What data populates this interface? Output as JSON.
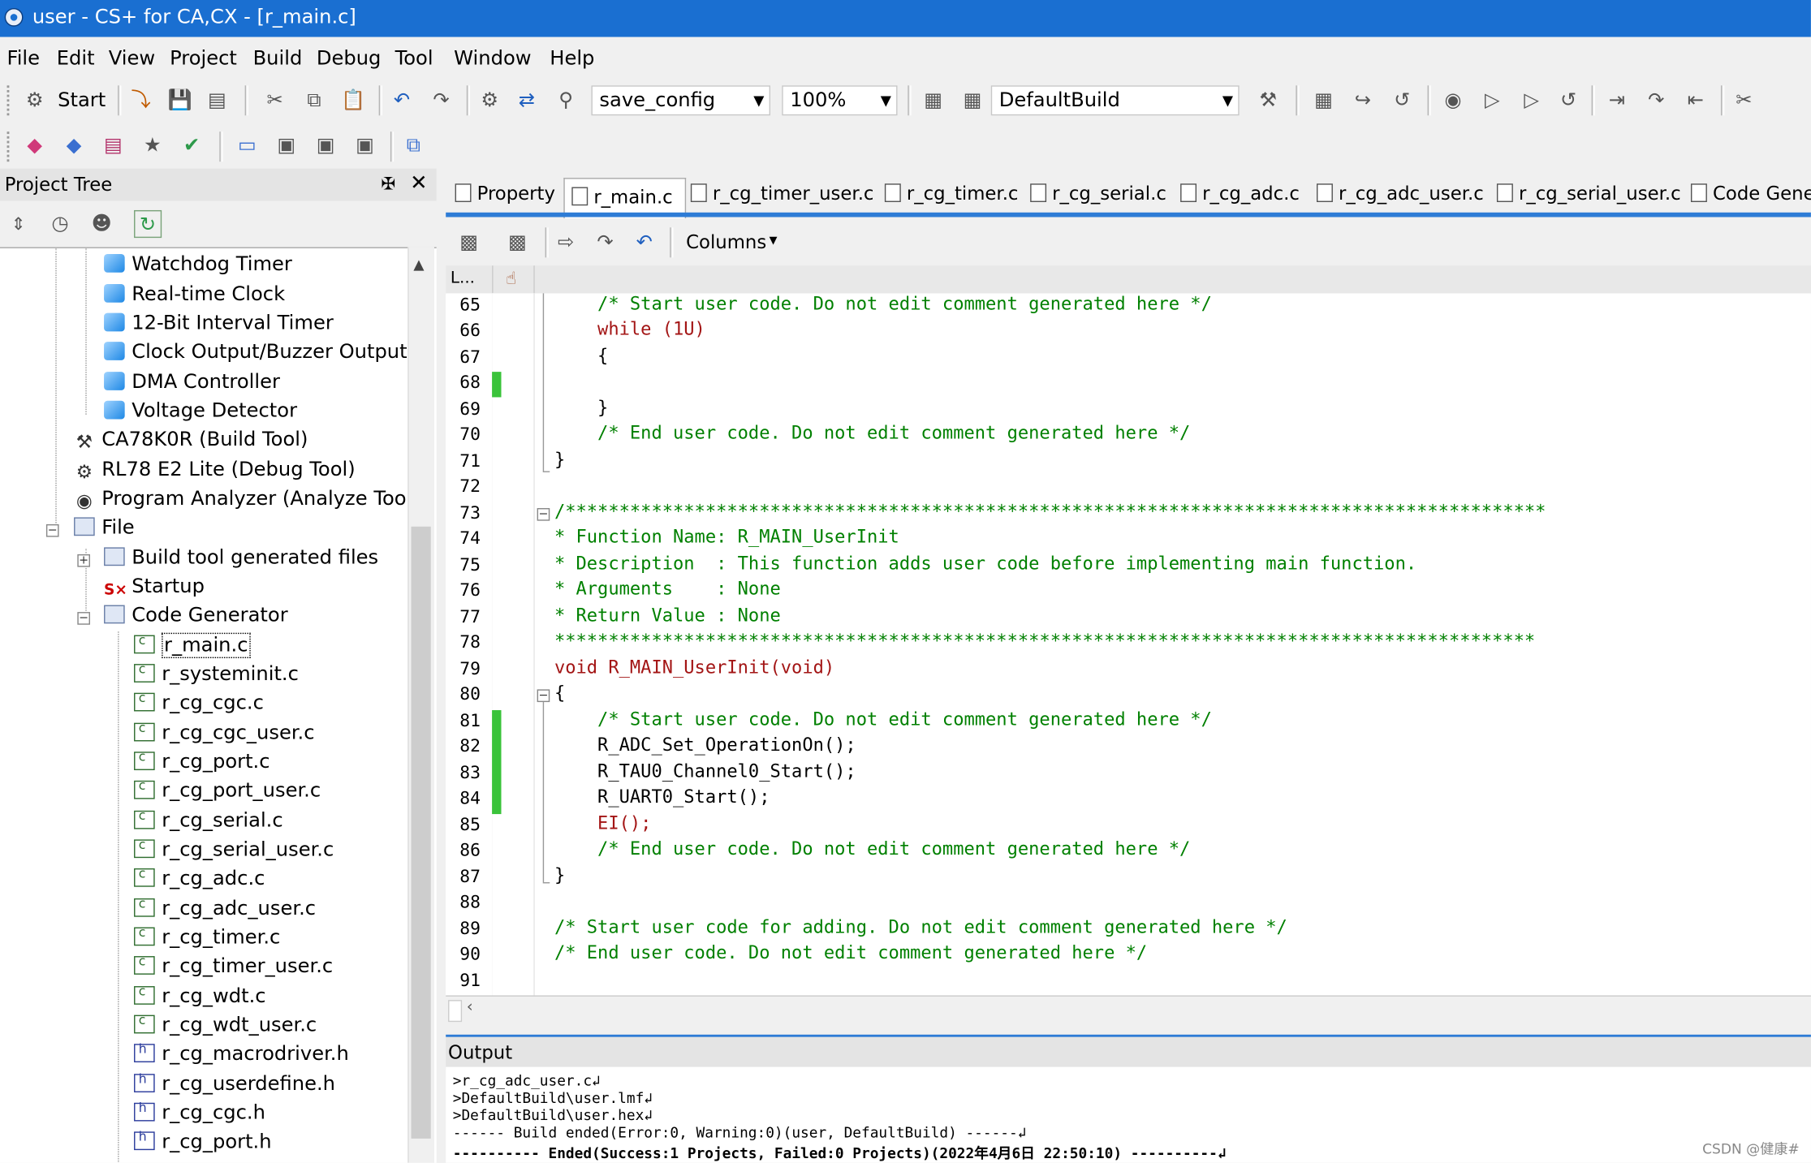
{
  "window": {
    "title": "user - CS+ for CA,CX - [r_main.c]"
  },
  "menu": [
    "File",
    "Edit",
    "View",
    "Project",
    "Build",
    "Debug",
    "Tool",
    "Window",
    "Help"
  ],
  "toolbar": {
    "start_label": "Start",
    "search_value": "save_config",
    "zoom_value": "100%",
    "build_mode": "DefaultBuild"
  },
  "project_tree": {
    "title": "Project Tree",
    "items": [
      {
        "label": "Watchdog Timer",
        "icon": "cube-icon"
      },
      {
        "label": "Real-time Clock",
        "icon": "cube-icon"
      },
      {
        "label": "12-Bit Interval Timer",
        "icon": "cube-icon"
      },
      {
        "label": "Clock Output/Buzzer Output",
        "icon": "cube-icon"
      },
      {
        "label": "DMA Controller",
        "icon": "cube-icon"
      },
      {
        "label": "Voltage Detector",
        "icon": "cube-icon"
      },
      {
        "label": "CA78K0R (Build Tool)",
        "icon": "hammer-icon"
      },
      {
        "label": "RL78 E2 Lite (Debug Tool)",
        "icon": "debugger-icon"
      },
      {
        "label": "Program Analyzer (Analyze Tool",
        "icon": "analyzer-icon"
      },
      {
        "label": "File",
        "icon": "folder-icon"
      },
      {
        "label": "Build tool generated files",
        "icon": "folder-icon"
      },
      {
        "label": "Startup",
        "icon": "startup-icon"
      },
      {
        "label": "Code Generator",
        "icon": "folder-icon"
      },
      {
        "label": "r_main.c",
        "icon": "c-file-icon"
      },
      {
        "label": "r_systeminit.c",
        "icon": "c-file-icon"
      },
      {
        "label": "r_cg_cgc.c",
        "icon": "c-file-icon"
      },
      {
        "label": "r_cg_cgc_user.c",
        "icon": "c-file-icon"
      },
      {
        "label": "r_cg_port.c",
        "icon": "c-file-icon"
      },
      {
        "label": "r_cg_port_user.c",
        "icon": "c-file-icon"
      },
      {
        "label": "r_cg_serial.c",
        "icon": "c-file-icon"
      },
      {
        "label": "r_cg_serial_user.c",
        "icon": "c-file-icon"
      },
      {
        "label": "r_cg_adc.c",
        "icon": "c-file-icon"
      },
      {
        "label": "r_cg_adc_user.c",
        "icon": "c-file-icon"
      },
      {
        "label": "r_cg_timer.c",
        "icon": "c-file-icon"
      },
      {
        "label": "r_cg_timer_user.c",
        "icon": "c-file-icon"
      },
      {
        "label": "r_cg_wdt.c",
        "icon": "c-file-icon"
      },
      {
        "label": "r_cg_wdt_user.c",
        "icon": "c-file-icon"
      },
      {
        "label": "r_cg_macrodriver.h",
        "icon": "h-file-icon"
      },
      {
        "label": "r_cg_userdefine.h",
        "icon": "h-file-icon"
      },
      {
        "label": "r_cg_cgc.h",
        "icon": "h-file-icon"
      },
      {
        "label": "r_cg_port.h",
        "icon": "h-file-icon"
      }
    ]
  },
  "tabs": [
    "Property",
    "r_main.c",
    "r_cg_timer_user.c",
    "r_cg_timer.c",
    "r_cg_serial.c",
    "r_cg_adc.c",
    "r_cg_adc_user.c",
    "r_cg_serial_user.c",
    "Code Gene"
  ],
  "editor": {
    "columns_label": "Columns",
    "gutter_header": "L...",
    "lines": [
      {
        "n": "65",
        "text": "    /* Start user code. Do not edit comment generated here */",
        "cls": "c-com"
      },
      {
        "n": "66",
        "text": "    while (1U)",
        "cls": "c-kw"
      },
      {
        "n": "67",
        "text": "    {",
        "cls": "c-def"
      },
      {
        "n": "68",
        "text": "",
        "cls": "c-def"
      },
      {
        "n": "69",
        "text": "    }",
        "cls": "c-def"
      },
      {
        "n": "70",
        "text": "    /* End user code. Do not edit comment generated here */",
        "cls": "c-com"
      },
      {
        "n": "71",
        "text": "}",
        "cls": "c-def"
      },
      {
        "n": "72",
        "text": "",
        "cls": "c-def"
      },
      {
        "n": "73",
        "text": "/*******************************************************************************************",
        "cls": "c-com"
      },
      {
        "n": "74",
        "text": "* Function Name: R_MAIN_UserInit",
        "cls": "c-com"
      },
      {
        "n": "75",
        "text": "* Description  : This function adds user code before implementing main function.",
        "cls": "c-com"
      },
      {
        "n": "76",
        "text": "* Arguments    : None",
        "cls": "c-com"
      },
      {
        "n": "77",
        "text": "* Return Value : None",
        "cls": "c-com"
      },
      {
        "n": "78",
        "text": "*******************************************************************************************",
        "cls": "c-com"
      },
      {
        "n": "79",
        "text": "void R_MAIN_UserInit(void)",
        "cls": "c-kw"
      },
      {
        "n": "80",
        "text": "{",
        "cls": "c-def"
      },
      {
        "n": "81",
        "text": "    /* Start user code. Do not edit comment generated here */",
        "cls": "c-com"
      },
      {
        "n": "82",
        "text": "    R_ADC_Set_OperationOn();",
        "cls": "c-def"
      },
      {
        "n": "83",
        "text": "    R_TAU0_Channel0_Start();",
        "cls": "c-def"
      },
      {
        "n": "84",
        "text": "    R_UART0_Start();",
        "cls": "c-def"
      },
      {
        "n": "85",
        "text": "    EI();",
        "cls": "c-kw"
      },
      {
        "n": "86",
        "text": "    /* End user code. Do not edit comment generated here */",
        "cls": "c-com"
      },
      {
        "n": "87",
        "text": "}",
        "cls": "c-def"
      },
      {
        "n": "88",
        "text": "",
        "cls": "c-def"
      },
      {
        "n": "89",
        "text": "/* Start user code for adding. Do not edit comment generated here */",
        "cls": "c-com"
      },
      {
        "n": "90",
        "text": "/* End user code. Do not edit comment generated here */",
        "cls": "c-com"
      },
      {
        "n": "91",
        "text": "",
        "cls": "c-def"
      }
    ]
  },
  "output": {
    "title": "Output",
    "lines": [
      ">r_cg_adc_user.c↲",
      ">DefaultBuild\\user.lmf↲",
      ">DefaultBuild\\user.hex↲",
      "------ Build ended(Error:0, Warning:0)(user, DefaultBuild) ------↲",
      "---------- Ended(Success:1 Projects, Failed:0 Projects)(2022年4月6日 22:50:10) ----------↲"
    ]
  },
  "watermark": "CSDN @健康#"
}
